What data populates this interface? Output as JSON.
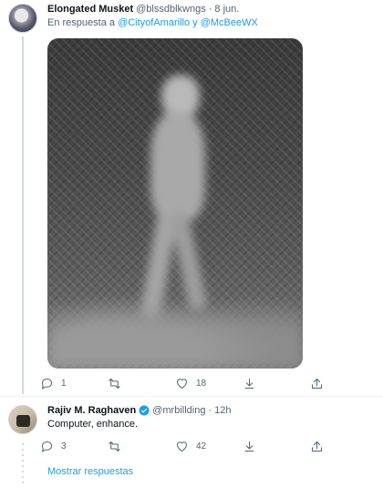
{
  "tweets": [
    {
      "author_name": "Elongated Musket",
      "handle": "@blssdblkwngs",
      "separator": "·",
      "date": "8 jun.",
      "reply_prefix": "En respuesta a",
      "reply_targets": "@CityofAmarillo y @McBeeWX",
      "has_media": true,
      "actions": {
        "reply_count": "1",
        "retweet_count": "",
        "like_count": "18"
      }
    },
    {
      "author_name": "Rajiv M. Raghaven",
      "verified": true,
      "handle": "@mrbillding",
      "separator": "·",
      "date": "12h",
      "text": "Computer, enhance.",
      "actions": {
        "reply_count": "3",
        "retweet_count": "",
        "like_count": "42"
      }
    }
  ],
  "show_replies_label": "Mostrar respuestas",
  "colors": {
    "link": "#1d9bf0",
    "muted": "#536471",
    "text": "#0f1419",
    "thread_line": "#cfd9de"
  },
  "icons": [
    "reply-icon",
    "retweet-icon",
    "like-icon",
    "share-icon",
    "upload-icon",
    "verified-badge-icon"
  ]
}
